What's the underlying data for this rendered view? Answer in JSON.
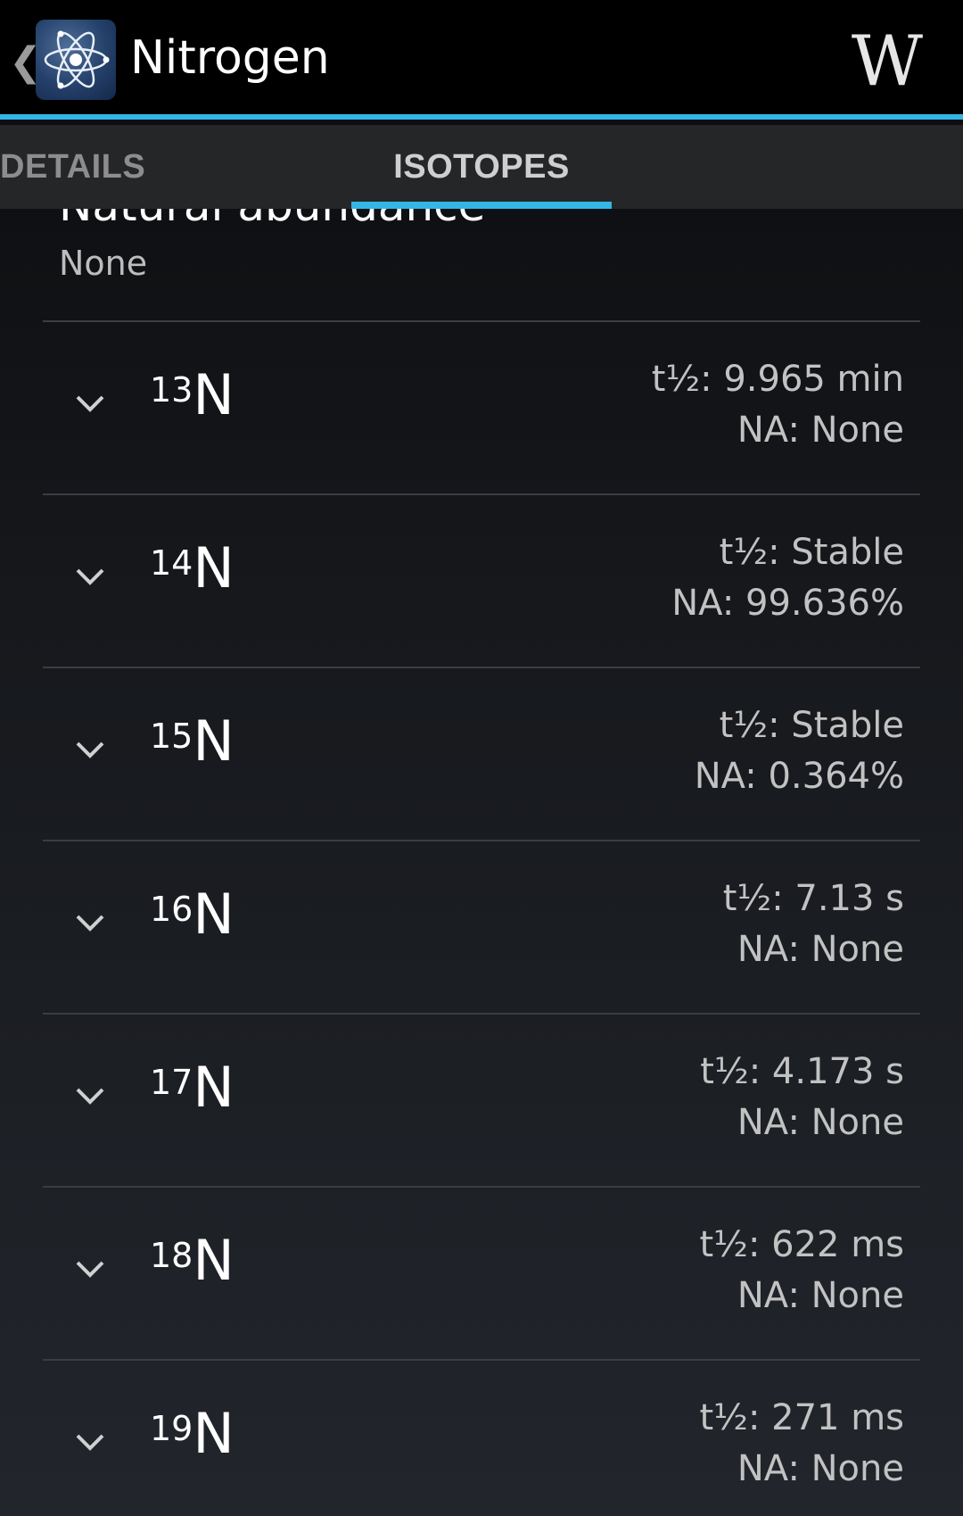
{
  "header": {
    "title": "Nitrogen",
    "up_caret": "❮",
    "wiki_label": "W"
  },
  "tabs": [
    {
      "label": "DETAILS",
      "selected": false
    },
    {
      "label": "ISOTOPES",
      "selected": true
    }
  ],
  "natural_abundance": {
    "label": "Natural abundance",
    "value": "None"
  },
  "isotopes": [
    {
      "mass": "13",
      "symbol": "N",
      "half_life": "t½: 9.965 min",
      "abundance": "NA: None"
    },
    {
      "mass": "14",
      "symbol": "N",
      "half_life": "t½: Stable",
      "abundance": "NA: 99.636%"
    },
    {
      "mass": "15",
      "symbol": "N",
      "half_life": "t½: Stable",
      "abundance": "NA: 0.364%"
    },
    {
      "mass": "16",
      "symbol": "N",
      "half_life": "t½: 7.13 s",
      "abundance": "NA: None"
    },
    {
      "mass": "17",
      "symbol": "N",
      "half_life": "t½: 4.173 s",
      "abundance": "NA: None"
    },
    {
      "mass": "18",
      "symbol": "N",
      "half_life": "t½: 622 ms",
      "abundance": "NA: None"
    },
    {
      "mass": "19",
      "symbol": "N",
      "half_life": "t½: 271 ms",
      "abundance": "NA: None"
    }
  ],
  "colors": {
    "accent": "#33b5e5",
    "action_bar": "#000000",
    "tab_bar": "#252628"
  }
}
